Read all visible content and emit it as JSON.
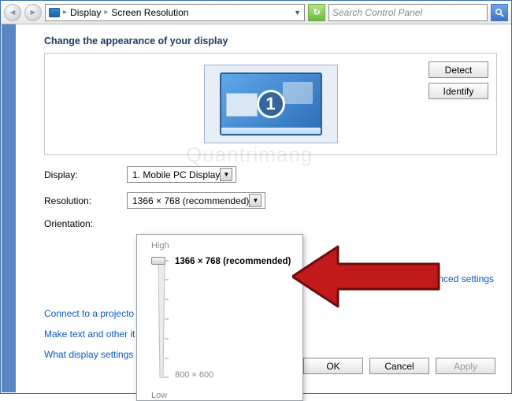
{
  "toolbar": {
    "crumb1": "Display",
    "crumb2": "Screen Resolution",
    "search_placeholder": "Search Control Panel"
  },
  "heading": "Change the appearance of your display",
  "buttons": {
    "detect": "Detect",
    "identify": "Identify",
    "ok": "OK",
    "cancel": "Cancel",
    "apply": "Apply"
  },
  "monitor_number": "1",
  "labels": {
    "display": "Display:",
    "resolution": "Resolution:",
    "orientation": "Orientation:"
  },
  "combos": {
    "display": "1. Mobile PC Display",
    "resolution": "1366 × 768 (recommended)"
  },
  "slider": {
    "high": "High",
    "low": "Low",
    "current": "1366 × 768 (recommended)",
    "min": "800 × 600"
  },
  "links": {
    "projector": "Connect to a projecto",
    "text_size": "Make text and other it",
    "best_settings": "What display settings",
    "advanced": "Advanced settings"
  },
  "watermark": "Quantrimang"
}
